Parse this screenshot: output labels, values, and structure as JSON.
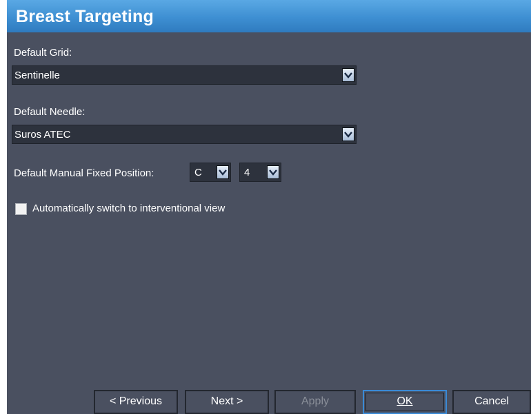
{
  "title": "Breast Targeting",
  "fields": {
    "grid": {
      "label": "Default Grid:",
      "value": "Sentinelle"
    },
    "needle": {
      "label": "Default Needle:",
      "value": "Suros ATEC"
    },
    "fixed_position": {
      "label": "Default Manual Fixed Position:",
      "col_value": "C",
      "row_value": "4"
    }
  },
  "checkbox": {
    "label": "Automatically switch to interventional view",
    "checked": false
  },
  "buttons": {
    "previous": "< Previous",
    "next": "Next >",
    "apply": "Apply",
    "ok": "OK",
    "cancel": "Cancel"
  },
  "icons": {
    "dropdown": "chevron-down-icon"
  },
  "colors": {
    "background": "#4a5060",
    "titlebar": "#3e8fd2",
    "field": "#2d323d"
  }
}
